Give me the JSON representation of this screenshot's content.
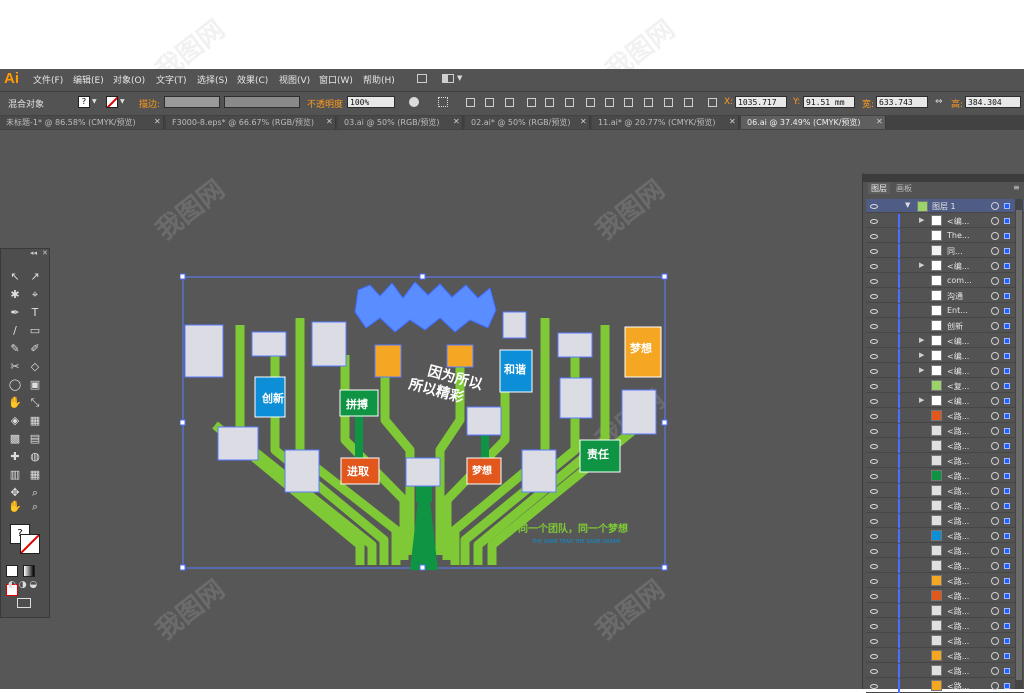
{
  "app": {
    "logo": "Ai"
  },
  "menu": [
    "文件(F)",
    "编辑(E)",
    "对象(O)",
    "文字(T)",
    "选择(S)",
    "效果(C)",
    "视图(V)",
    "窗口(W)",
    "帮助(H)"
  ],
  "control": {
    "object_type": "混合对象",
    "stroke_label": "描边:",
    "opacity_label": "不透明度",
    "opacity_value": "100%",
    "x_label": "X:",
    "x_value": "1035.717",
    "y_label": "Y:",
    "y_value": "91.51 mm",
    "w_label": "宽:",
    "w_value": "633.743",
    "h_label": "高:",
    "h_value": "384.304"
  },
  "tabs": [
    {
      "label": "未标题-1* @ 86.58% (CMYK/预览)"
    },
    {
      "label": "F3000-8.eps* @ 66.67% (RGB/预览)"
    },
    {
      "label": "03.ai @ 50% (RGB/预览)"
    },
    {
      "label": "02.ai* @ 50% (RGB/预览)"
    },
    {
      "label": "11.ai* @ 20.77% (CMYK/预览)"
    },
    {
      "label": "06.ai @ 37.49% (CMYK/预览)"
    }
  ],
  "watermark": "我图网",
  "artwork": {
    "slogan_line1": "因为所以",
    "slogan_line2": "所以精彩",
    "badges": [
      "创新",
      "拼搏",
      "进取",
      "和谐",
      "梦想",
      "责任",
      "梦想"
    ],
    "footer_cn": "同一个团队，同一个梦想",
    "footer_en": "THE SAME TEAM THE SAME DREAM",
    "colors": {
      "green": "#7ec935",
      "dark_green": "#0e9443",
      "blue": "#0c8fd6",
      "orange": "#f5a623",
      "red": "#e2571c",
      "frame": "#dcdde4",
      "selection": "#4d6fff"
    }
  },
  "layers_panel": {
    "tab_layers": "图层",
    "tab_artboards": "画板",
    "top_layer": "图层 1",
    "rows": [
      {
        "name": "<编...",
        "expand": true,
        "thumb": "#ffffff"
      },
      {
        "name": "The...",
        "expand": false,
        "thumb": "#ffffff"
      },
      {
        "name": "同...",
        "expand": false,
        "thumb": "#f2f2f2"
      },
      {
        "name": "<编...",
        "expand": true,
        "thumb": "#ffffff"
      },
      {
        "name": "com...",
        "expand": false,
        "thumb": "#ffffff"
      },
      {
        "name": "沟通",
        "expand": false,
        "thumb": "#ffffff"
      },
      {
        "name": "Ent...",
        "expand": false,
        "thumb": "#ffffff"
      },
      {
        "name": "创新",
        "expand": false,
        "thumb": "#ffffff"
      },
      {
        "name": "<编...",
        "expand": true,
        "thumb": "#ffffff"
      },
      {
        "name": "<编...",
        "expand": true,
        "thumb": "#ffffff"
      },
      {
        "name": "<编...",
        "expand": true,
        "thumb": "#ffffff"
      },
      {
        "name": "<复...",
        "expand": false,
        "thumb": "#9bd36a"
      },
      {
        "name": "<编...",
        "expand": true,
        "thumb": "#ffffff"
      },
      {
        "name": "<路...",
        "expand": false,
        "thumb": "#e2571c"
      },
      {
        "name": "<路...",
        "expand": false,
        "thumb": "#e0e0e0"
      },
      {
        "name": "<路...",
        "expand": false,
        "thumb": "#e0e0e0"
      },
      {
        "name": "<路...",
        "expand": false,
        "thumb": "#e0e0e0"
      },
      {
        "name": "<路...",
        "expand": false,
        "thumb": "#0e9443"
      },
      {
        "name": "<路...",
        "expand": false,
        "thumb": "#e0e0e0"
      },
      {
        "name": "<路...",
        "expand": false,
        "thumb": "#e0e0e0"
      },
      {
        "name": "<路...",
        "expand": false,
        "thumb": "#e0e0e0"
      },
      {
        "name": "<路...",
        "expand": false,
        "thumb": "#0c8fd6"
      },
      {
        "name": "<路...",
        "expand": false,
        "thumb": "#e0e0e0"
      },
      {
        "name": "<路...",
        "expand": false,
        "thumb": "#e0e0e0"
      },
      {
        "name": "<路...",
        "expand": false,
        "thumb": "#f5a623"
      },
      {
        "name": "<路...",
        "expand": false,
        "thumb": "#e2571c"
      },
      {
        "name": "<路...",
        "expand": false,
        "thumb": "#e0e0e0"
      },
      {
        "name": "<路...",
        "expand": false,
        "thumb": "#e0e0e0"
      },
      {
        "name": "<路...",
        "expand": false,
        "thumb": "#e0e0e0"
      },
      {
        "name": "<路...",
        "expand": false,
        "thumb": "#f5a623"
      },
      {
        "name": "<路...",
        "expand": false,
        "thumb": "#e0e0e0"
      },
      {
        "name": "<路...",
        "expand": false,
        "thumb": "#f5a623"
      }
    ]
  }
}
